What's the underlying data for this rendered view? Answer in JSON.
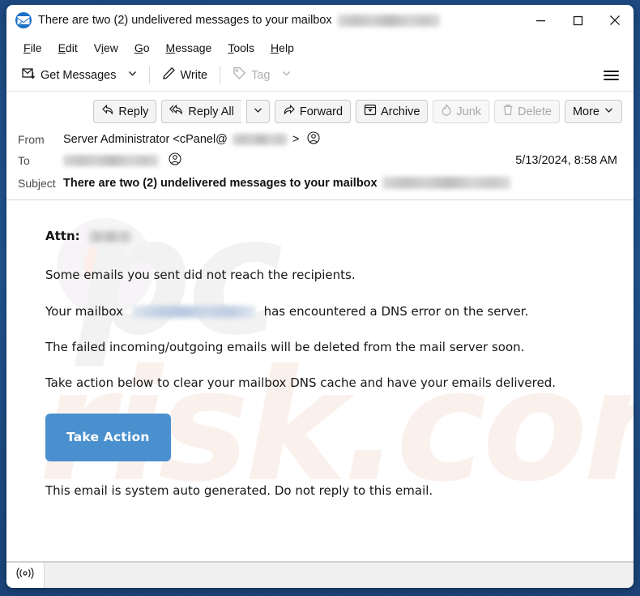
{
  "window": {
    "title": "There are two (2) undelivered messages to your mailbox",
    "app_icon": "thunderbird-icon",
    "controls": {
      "minimize": "minimize-icon",
      "maximize": "maximize-icon",
      "close": "close-icon"
    }
  },
  "menubar": {
    "items": [
      {
        "label": "File",
        "accesskey": "F"
      },
      {
        "label": "Edit",
        "accesskey": "E"
      },
      {
        "label": "View",
        "accesskey": "V"
      },
      {
        "label": "Go",
        "accesskey": "G"
      },
      {
        "label": "Message",
        "accesskey": "M"
      },
      {
        "label": "Tools",
        "accesskey": "T"
      },
      {
        "label": "Help",
        "accesskey": "H"
      }
    ]
  },
  "toolbar": {
    "get_messages": "Get Messages",
    "get_messages_icon": "inbox-download-icon",
    "get_messages_caret": "chevron-down-icon",
    "write": "Write",
    "write_icon": "pencil-icon",
    "tag": "Tag",
    "tag_icon": "tag-icon",
    "tag_caret": "chevron-down-icon",
    "tag_disabled": true,
    "app_menu_icon": "hamburger-menu-icon"
  },
  "message_actions": [
    {
      "label": "Reply",
      "icon": "reply-icon",
      "disabled": false
    },
    {
      "label": "Reply All",
      "icon": "reply-all-icon",
      "disabled": false
    },
    {
      "label": "",
      "icon": "chevron-down-icon",
      "disabled": false
    },
    {
      "label": "Forward",
      "icon": "forward-icon",
      "disabled": false
    },
    {
      "label": "Archive",
      "icon": "archive-icon",
      "disabled": false
    },
    {
      "label": "Junk",
      "icon": "flame-icon",
      "disabled": true
    },
    {
      "label": "Delete",
      "icon": "trash-icon",
      "disabled": true
    },
    {
      "label": "More",
      "icon": "chevron-down-icon",
      "disabled": false
    }
  ],
  "message_header": {
    "from_label": "From",
    "from_value_prefix": "Server Administrator <cPanel@",
    "from_value_suffix": ">",
    "from_redacted": true,
    "from_avatar_icon": "contact-avatar-icon",
    "to_label": "To",
    "to_redacted": true,
    "to_avatar_icon": "contact-avatar-icon",
    "date": "5/13/2024, 8:58 AM",
    "subject_label": "Subject",
    "subject_value": "There are two (2) undelivered messages to your mailbox",
    "subject_redacted": true
  },
  "body": {
    "attn_label": "Attn:",
    "attn_redacted": true,
    "line_1": "Some emails you sent did not reach the recipients.",
    "line_2_prefix": "Your mailbox",
    "line_2_suffix": "has encountered a DNS error on the server.",
    "line_2_redacted": true,
    "line_3": "The failed incoming/outgoing emails will be deleted from the mail server soon.",
    "line_4": "Take action below to clear your mailbox DNS cache and have your emails delivered.",
    "cta_label": "Take Action",
    "cta_color": "#4a90cf",
    "footer": "This email is system auto generated. Do not reply to this email.",
    "watermark_part_1": "pc",
    "watermark_part_2": "risk.com"
  },
  "statusbar": {
    "icon": "broadcast-signal-icon"
  }
}
